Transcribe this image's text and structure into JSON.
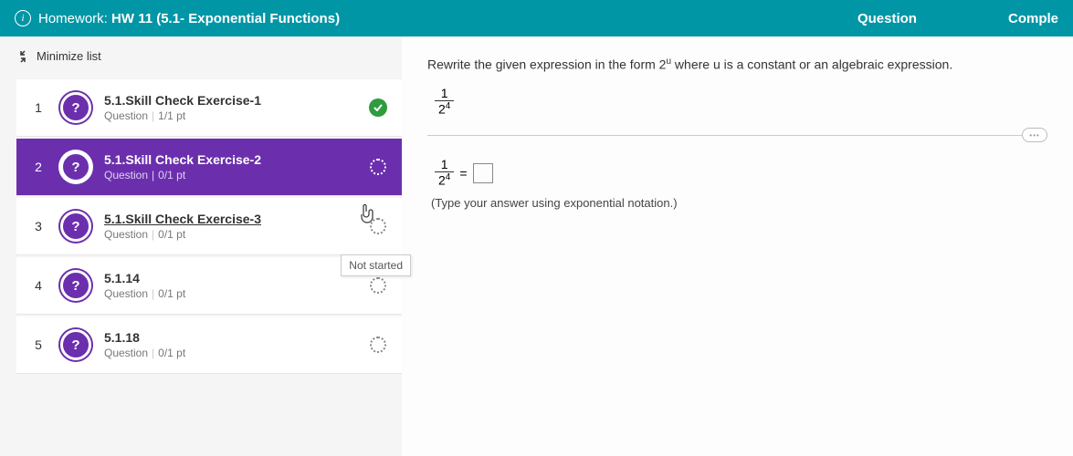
{
  "header": {
    "title_prefix": "Homework:",
    "title": "HW 11 (5.1- Exponential Functions)",
    "center": "Question",
    "right": "Comple"
  },
  "sidebar": {
    "minimize_label": "Minimize list",
    "items": [
      {
        "num": "1",
        "title": "5.1.Skill Check Exercise-1",
        "meta_label": "Question",
        "pts": "1/1 pt",
        "status": "done",
        "selected": false,
        "hover": false
      },
      {
        "num": "2",
        "title": "5.1.Skill Check Exercise-2",
        "meta_label": "Question",
        "pts": "0/1 pt",
        "status": "open",
        "selected": true,
        "hover": false
      },
      {
        "num": "3",
        "title": "5.1.Skill Check Exercise-3",
        "meta_label": "Question",
        "pts": "0/1 pt",
        "status": "open",
        "selected": false,
        "hover": true
      },
      {
        "num": "4",
        "title": "5.1.14",
        "meta_label": "Question",
        "pts": "0/1 pt",
        "status": "open",
        "selected": false,
        "hover": false
      },
      {
        "num": "5",
        "title": "5.1.18",
        "meta_label": "Question",
        "pts": "0/1 pt",
        "status": "open",
        "selected": false,
        "hover": false
      }
    ],
    "tooltip": "Not started"
  },
  "main": {
    "prompt_before": "Rewrite the given expression in the form 2",
    "prompt_exp": "u",
    "prompt_after": " where u is a constant or an algebraic expression.",
    "frac_top": "1",
    "frac_bot_base": "2",
    "frac_bot_exp": "4",
    "equals": " = ",
    "hint": "(Type your answer using exponential notation.)",
    "handle_dots": "•••"
  }
}
